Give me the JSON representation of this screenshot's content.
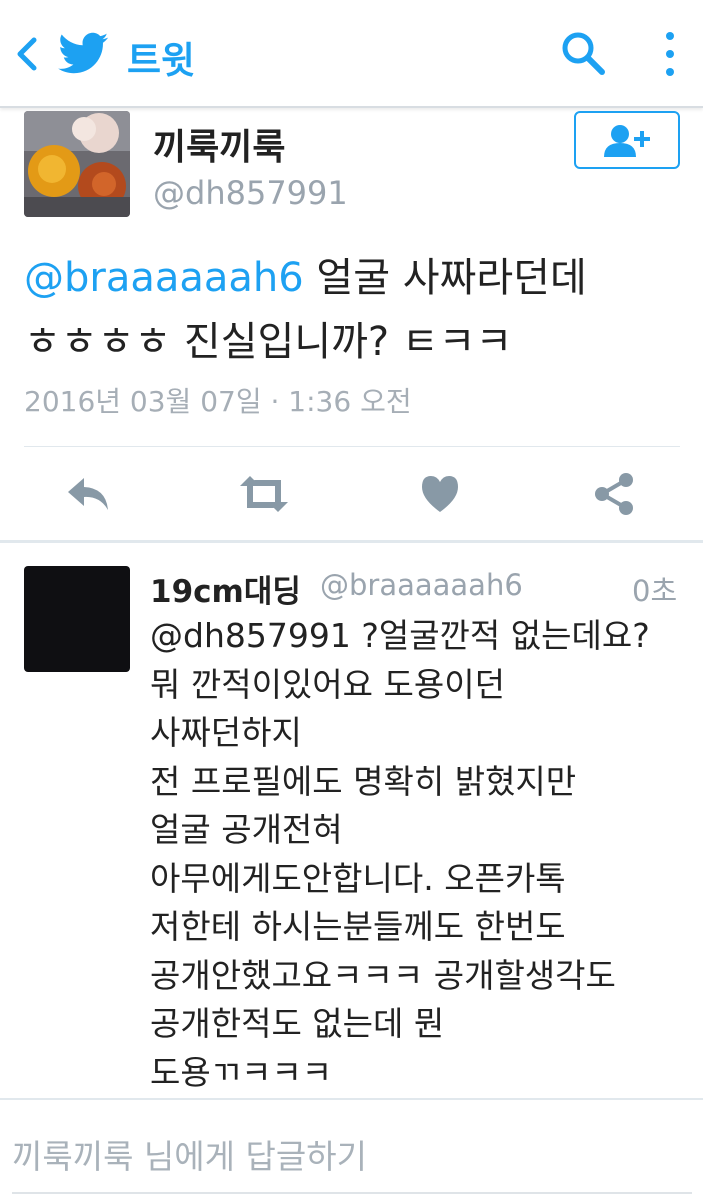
{
  "colors": {
    "accent": "#1da1f2",
    "muted": "#9aa4ae",
    "icon_gray": "#8899a6",
    "divider": "#e1e8ed"
  },
  "topbar": {
    "title": "트윗",
    "back_icon": "chevron-left-icon",
    "logo_icon": "twitter-bird-icon",
    "search_icon": "search-icon",
    "menu_icon": "more-vertical-icon"
  },
  "tweet": {
    "author_name": "끼룩끼룩",
    "author_handle": "@dh857991",
    "mention": "@braaaaaah6",
    "text_line1_rest": " 얼굴 사짜라던데",
    "text_line2": "ㅎㅎㅎㅎ 진실입니까? ㅌㅋㅋ",
    "timestamp": "2016년 03월 07일 · 1:36 오전",
    "actions": [
      "reply-icon",
      "retweet-icon",
      "like-icon",
      "share-icon"
    ]
  },
  "reply": {
    "author_name": "19cm대딩",
    "author_handle": "@braaaaaah6",
    "time": "0초",
    "lines": [
      "@dh857991 ?얼굴깐적 없는데요?",
      "뭐 깐적이있어요 도용이던",
      "사짜던하지",
      "전 프로필에도 명확히 밝혔지만",
      "얼굴 공개전혀",
      "아무에게도안합니다. 오픈카톡",
      "저한테 하시는분들께도 한번도",
      "공개안했고요ㅋㅋㅋ 공개할생각도",
      "공개한적도 없는데 뭔",
      "도용ㄲㅋㅋㅋ"
    ]
  },
  "compose": {
    "placeholder": "끼룩끼룩 님에게 답글하기"
  }
}
